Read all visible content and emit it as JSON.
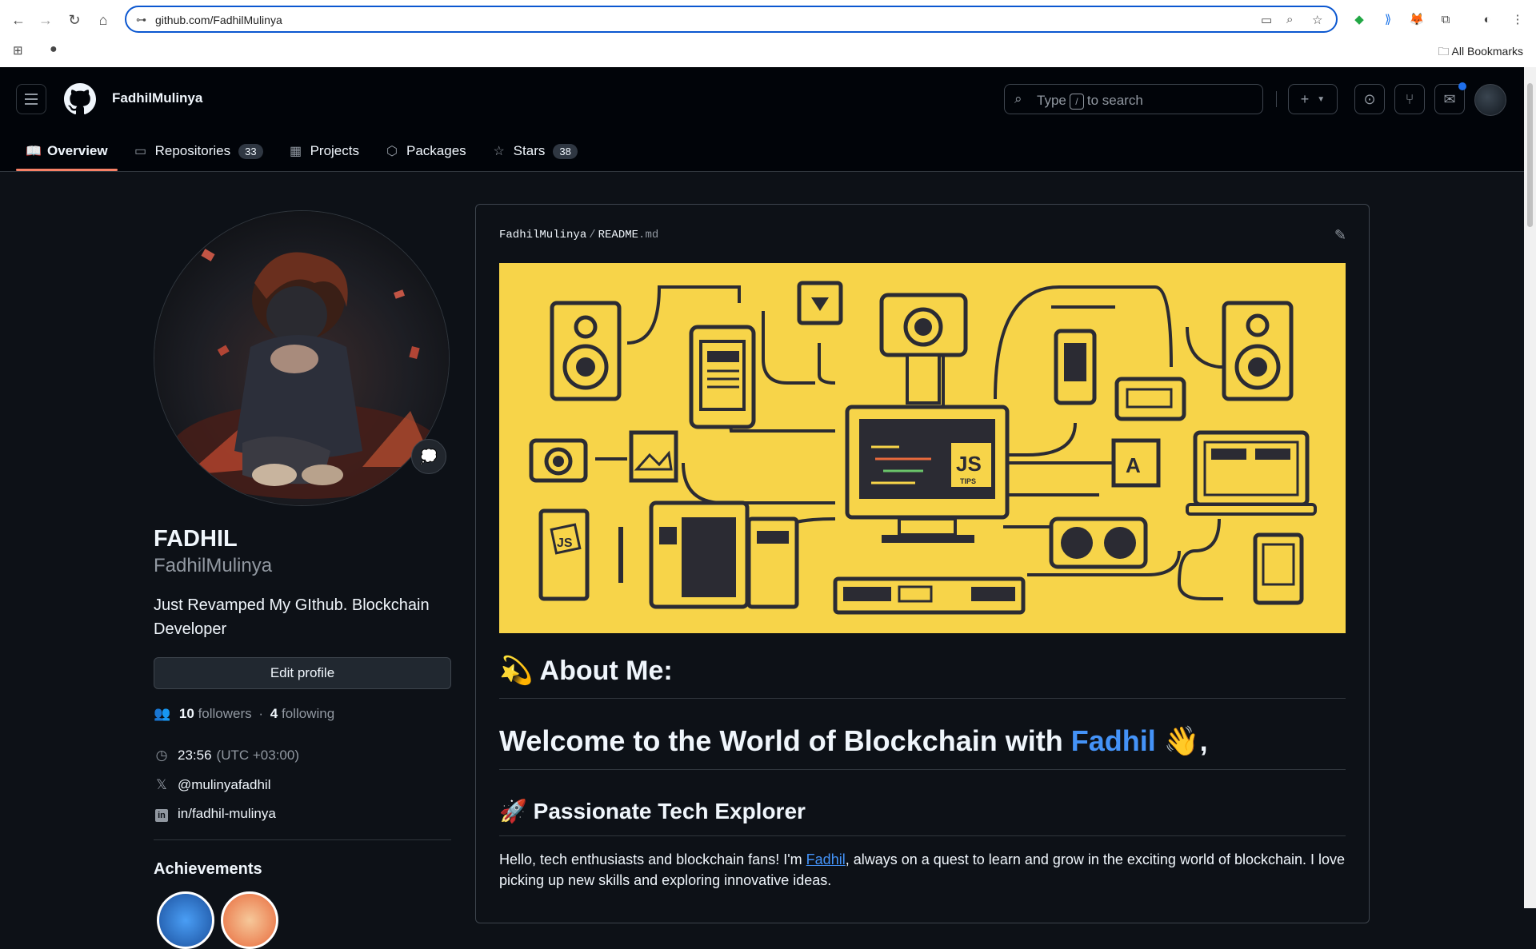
{
  "browser": {
    "url": "github.com/FadhilMulinya",
    "all_bookmarks": "All Bookmarks"
  },
  "header": {
    "username": "FadhilMulinya",
    "search_prefix": "Type",
    "search_key": "/",
    "search_suffix": "to search",
    "plus": "+"
  },
  "tabs": [
    {
      "label": "Overview"
    },
    {
      "label": "Repositories",
      "count": "33"
    },
    {
      "label": "Projects"
    },
    {
      "label": "Packages"
    },
    {
      "label": "Stars",
      "count": "38"
    }
  ],
  "profile": {
    "name": "FADHIL",
    "login": "FadhilMulinya",
    "bio": "Just Revamped My GIthub. Blockchain Developer",
    "edit_label": "Edit profile",
    "followers_count": "10",
    "followers_label": "followers",
    "sep": "·",
    "following_count": "4",
    "following_label": "following",
    "time": "23:56",
    "timezone": "(UTC +03:00)",
    "twitter": "@mulinyafadhil",
    "linkedin": "in/fadhil-mulinya",
    "achievements_title": "Achievements"
  },
  "readme": {
    "owner": "FadhilMulinya",
    "sep": "/",
    "file": "README",
    "file_ext": ".md",
    "about_title": "💫 About Me:",
    "welcome_prefix": "Welcome to the World of Blockchain with",
    "welcome_name": "Fadhil",
    "welcome_suffix": "👋,",
    "section_title": "🚀 Passionate Tech Explorer",
    "para_prefix": "Hello, tech enthusiasts and blockchain fans! I'm",
    "para_link": "Fadhil",
    "para_suffix": ", always on a quest to learn and grow in the exciting world of blockchain. I love picking up new skills and exploring innovative ideas.",
    "banner_js_label": "JS",
    "banner_tips_label": "TIPS",
    "banner_notebook_label": "JS",
    "banner_tablet_label": "A"
  },
  "colors": {
    "bg": "#0d1117",
    "accent_tab": "#f78166",
    "link": "#4493f8",
    "banner_yellow": "#f7d449"
  },
  "icons": [
    "back-icon",
    "forward-icon",
    "reload-icon",
    "home-icon",
    "site-info-icon",
    "cast-icon",
    "zoom-icon",
    "star-icon",
    "extension-icon",
    "profile-icon",
    "menu-icon",
    "github-logo",
    "search-icon",
    "issues-icon",
    "pull-requests-icon",
    "inbox-icon",
    "book-icon",
    "repo-icon",
    "table-icon",
    "package-icon",
    "people-icon",
    "clock-icon",
    "x-logo-icon",
    "linkedin-icon",
    "pencil-icon"
  ]
}
